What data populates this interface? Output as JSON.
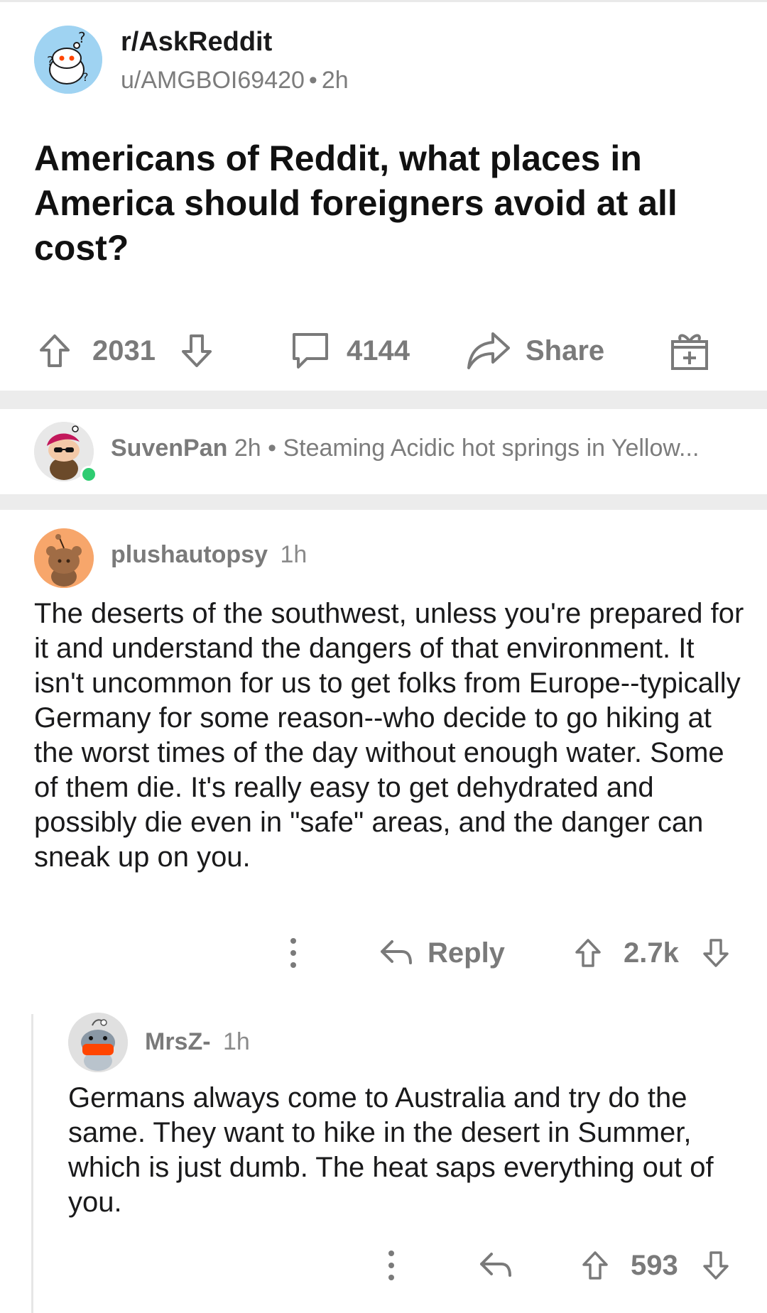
{
  "post": {
    "subreddit": "r/AskReddit",
    "author": "u/AMGBOI69420",
    "separator": "•",
    "age": "2h",
    "title": "Americans of Reddit, what places in America should foreigners avoid at all cost?",
    "upvotes": "2031",
    "comments": "4144",
    "share_label": "Share"
  },
  "pinned_comment": {
    "username": "SuvenPan",
    "age": "2h",
    "separator": "•",
    "preview": "Steaming Acidic hot springs in Yellow..."
  },
  "comments": [
    {
      "username": "plushautopsy",
      "age": "1h",
      "body": "The deserts of the southwest, unless you're prepared for it and understand the dangers of that environment. It isn't uncommon for us to get folks from Europe--typically Germany for some reason--who decide to go hiking at the worst times of the day without enough water. Some of them die. It's really easy to get dehydrated and possibly die even in \"safe\" areas, and the danger can sneak up on you.",
      "reply_label": "Reply",
      "score": "2.7k"
    },
    {
      "username": "MrsZ-",
      "age": "1h",
      "body": "Germans always come to Australia and try do the same. They want to hike in the desert in Summer, which is just dumb. The heat saps everything out of you.",
      "score": "593"
    }
  ],
  "colors": {
    "text": "#1a1a1b",
    "meta": "#7c7c7c",
    "icon": "#7a7a7a",
    "separator": "#ececec",
    "online": "#2ecc71"
  }
}
